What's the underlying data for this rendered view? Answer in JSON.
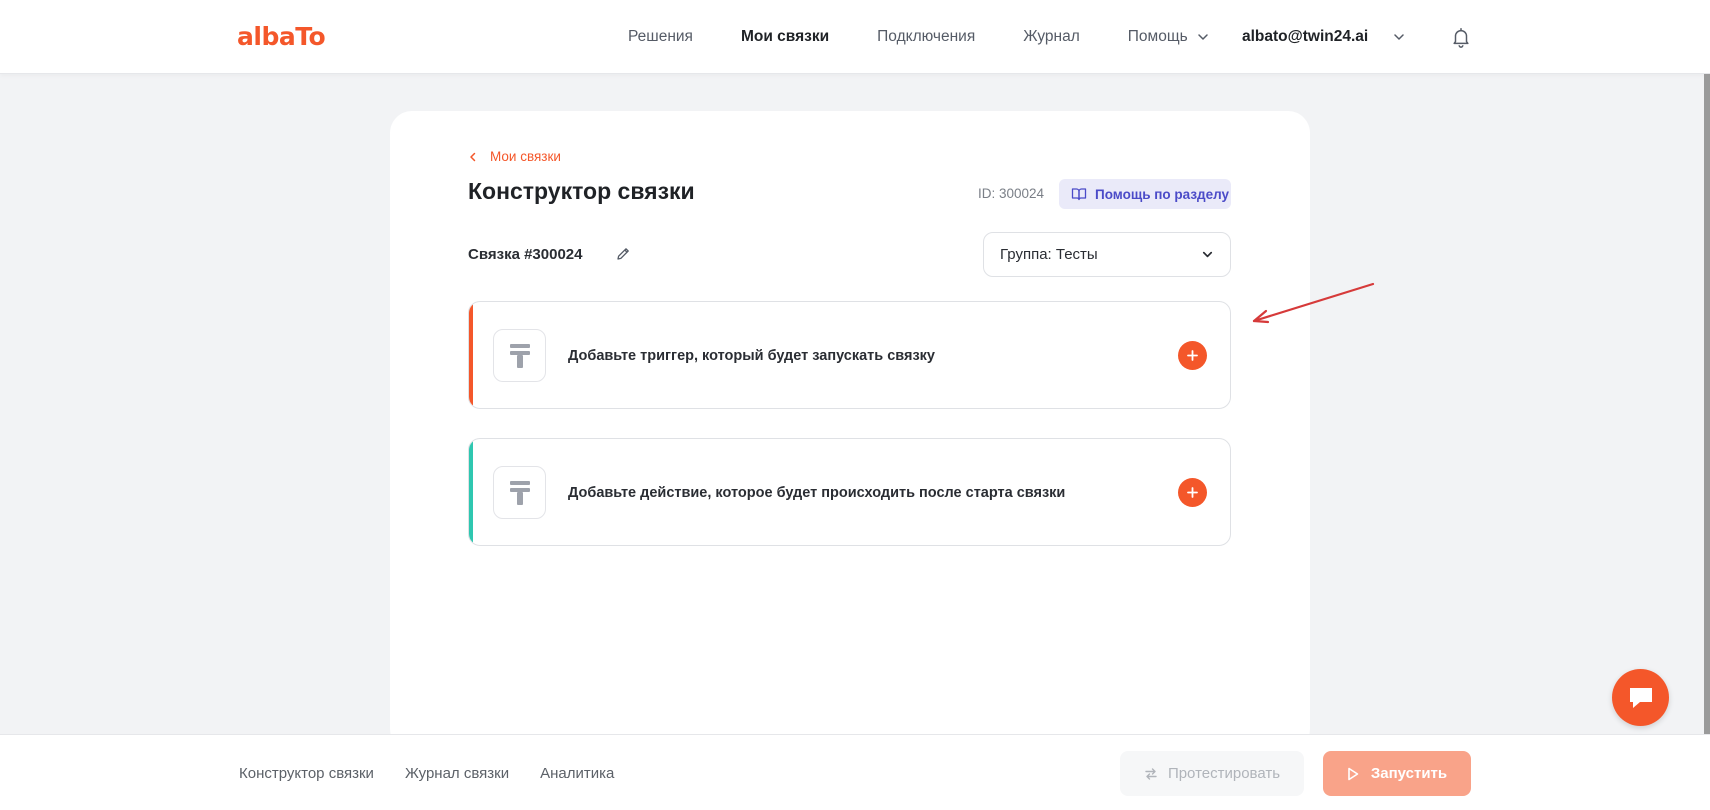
{
  "header": {
    "logo": "albaTo",
    "nav": [
      {
        "label": "Решения"
      },
      {
        "label": "Мои связки"
      },
      {
        "label": "Подключения"
      },
      {
        "label": "Журнал"
      },
      {
        "label": "Помощь"
      }
    ],
    "user_email": "albato@twin24.ai"
  },
  "breadcrumb": {
    "back_label": "Мои связки"
  },
  "page": {
    "title": "Конструктор связки",
    "id_text": "ID: 300024",
    "help_label": "Помощь по разделу",
    "bundle_name": "Связка #300024",
    "group_select_value": "Группа: Тесты"
  },
  "steps": [
    {
      "label": "Добавьте триггер, который будет запускать связку",
      "accent_color": "#f4572a"
    },
    {
      "label": "Добавьте действие, которое будет происходить после старта связки",
      "accent_color": "#2ec7b0"
    }
  ],
  "footer": {
    "tabs": [
      {
        "label": "Конструктор связки"
      },
      {
        "label": "Журнал связки"
      },
      {
        "label": "Аналитика"
      }
    ],
    "test_label": "Протестировать",
    "run_label": "Запустить"
  },
  "colors": {
    "brand": "#f4572a",
    "help_bg": "#eaeaf9",
    "help_text": "#4b4bc8",
    "annotation_arrow": "#d63a3a"
  },
  "icons": [
    "bell-icon",
    "chevron-down-icon",
    "chevron-left-icon",
    "book-icon",
    "pencil-icon",
    "placeholder-app-icon",
    "plus-icon",
    "swap-icon",
    "play-icon",
    "chat-icon"
  ]
}
